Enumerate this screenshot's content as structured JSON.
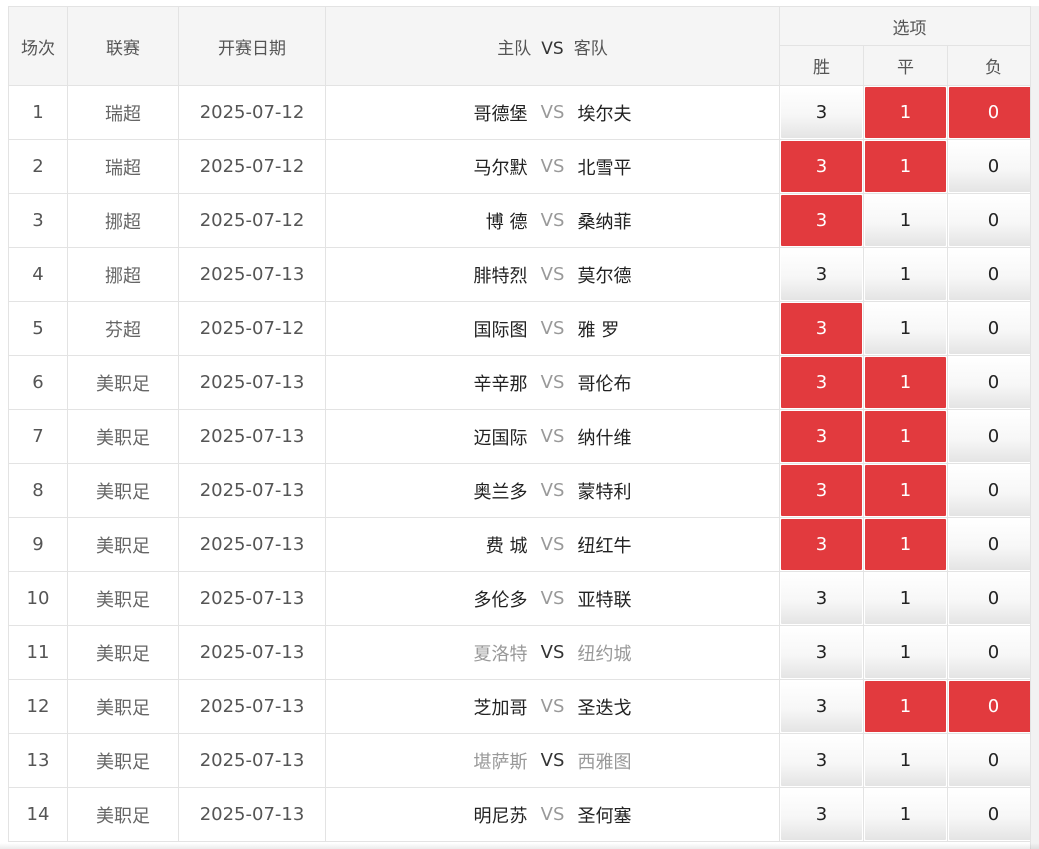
{
  "header": {
    "no": "场次",
    "league": "联赛",
    "date": "开赛日期",
    "home": "主队",
    "vs": "VS",
    "away": "客队",
    "options": "选项",
    "win": "胜",
    "draw": "平",
    "lose": "负"
  },
  "colors": {
    "selected": "#e23a3e",
    "header_bg": "#f5f5f5"
  },
  "rows": [
    {
      "no": "1",
      "league": "瑞超",
      "date": "2025-07-12",
      "home": "哥德堡",
      "vs": "VS",
      "away": "埃尔夫",
      "home_dim": false,
      "away_dim": false,
      "win": "3",
      "draw": "1",
      "lose": "0",
      "win_sel": false,
      "draw_sel": true,
      "lose_sel": true
    },
    {
      "no": "2",
      "league": "瑞超",
      "date": "2025-07-12",
      "home": "马尔默",
      "vs": "VS",
      "away": "北雪平",
      "home_dim": false,
      "away_dim": false,
      "win": "3",
      "draw": "1",
      "lose": "0",
      "win_sel": true,
      "draw_sel": true,
      "lose_sel": false
    },
    {
      "no": "3",
      "league": "挪超",
      "date": "2025-07-12",
      "home": "博 德",
      "vs": "VS",
      "away": "桑纳菲",
      "home_dim": false,
      "away_dim": false,
      "win": "3",
      "draw": "1",
      "lose": "0",
      "win_sel": true,
      "draw_sel": false,
      "lose_sel": false
    },
    {
      "no": "4",
      "league": "挪超",
      "date": "2025-07-13",
      "home": "腓特烈",
      "vs": "VS",
      "away": "莫尔德",
      "home_dim": false,
      "away_dim": false,
      "win": "3",
      "draw": "1",
      "lose": "0",
      "win_sel": false,
      "draw_sel": false,
      "lose_sel": false
    },
    {
      "no": "5",
      "league": "芬超",
      "date": "2025-07-12",
      "home": "国际图",
      "vs": "VS",
      "away": "雅 罗",
      "home_dim": false,
      "away_dim": false,
      "win": "3",
      "draw": "1",
      "lose": "0",
      "win_sel": true,
      "draw_sel": false,
      "lose_sel": false
    },
    {
      "no": "6",
      "league": "美职足",
      "date": "2025-07-13",
      "home": "辛辛那",
      "vs": "VS",
      "away": "哥伦布",
      "home_dim": false,
      "away_dim": false,
      "win": "3",
      "draw": "1",
      "lose": "0",
      "win_sel": true,
      "draw_sel": true,
      "lose_sel": false
    },
    {
      "no": "7",
      "league": "美职足",
      "date": "2025-07-13",
      "home": "迈国际",
      "vs": "VS",
      "away": "纳什维",
      "home_dim": false,
      "away_dim": false,
      "win": "3",
      "draw": "1",
      "lose": "0",
      "win_sel": true,
      "draw_sel": true,
      "lose_sel": false
    },
    {
      "no": "8",
      "league": "美职足",
      "date": "2025-07-13",
      "home": "奥兰多",
      "vs": "VS",
      "away": "蒙特利",
      "home_dim": false,
      "away_dim": false,
      "win": "3",
      "draw": "1",
      "lose": "0",
      "win_sel": true,
      "draw_sel": true,
      "lose_sel": false
    },
    {
      "no": "9",
      "league": "美职足",
      "date": "2025-07-13",
      "home": "费 城",
      "vs": "VS",
      "away": "纽红牛",
      "home_dim": false,
      "away_dim": false,
      "win": "3",
      "draw": "1",
      "lose": "0",
      "win_sel": true,
      "draw_sel": true,
      "lose_sel": false
    },
    {
      "no": "10",
      "league": "美职足",
      "date": "2025-07-13",
      "home": "多伦多",
      "vs": "VS",
      "away": "亚特联",
      "home_dim": false,
      "away_dim": false,
      "win": "3",
      "draw": "1",
      "lose": "0",
      "win_sel": false,
      "draw_sel": false,
      "lose_sel": false
    },
    {
      "no": "11",
      "league": "美职足",
      "date": "2025-07-13",
      "home": "夏洛特",
      "vs": "VS",
      "away": "纽约城",
      "home_dim": true,
      "away_dim": true,
      "win": "3",
      "draw": "1",
      "lose": "0",
      "win_sel": false,
      "draw_sel": false,
      "lose_sel": false
    },
    {
      "no": "12",
      "league": "美职足",
      "date": "2025-07-13",
      "home": "芝加哥",
      "vs": "VS",
      "away": "圣迭戈",
      "home_dim": false,
      "away_dim": false,
      "win": "3",
      "draw": "1",
      "lose": "0",
      "win_sel": false,
      "draw_sel": true,
      "lose_sel": true
    },
    {
      "no": "13",
      "league": "美职足",
      "date": "2025-07-13",
      "home": "堪萨斯",
      "vs": "VS",
      "away": "西雅图",
      "home_dim": true,
      "away_dim": true,
      "win": "3",
      "draw": "1",
      "lose": "0",
      "win_sel": false,
      "draw_sel": false,
      "lose_sel": false
    },
    {
      "no": "14",
      "league": "美职足",
      "date": "2025-07-13",
      "home": "明尼苏",
      "vs": "VS",
      "away": "圣何塞",
      "home_dim": false,
      "away_dim": false,
      "win": "3",
      "draw": "1",
      "lose": "0",
      "win_sel": false,
      "draw_sel": false,
      "lose_sel": false
    }
  ]
}
